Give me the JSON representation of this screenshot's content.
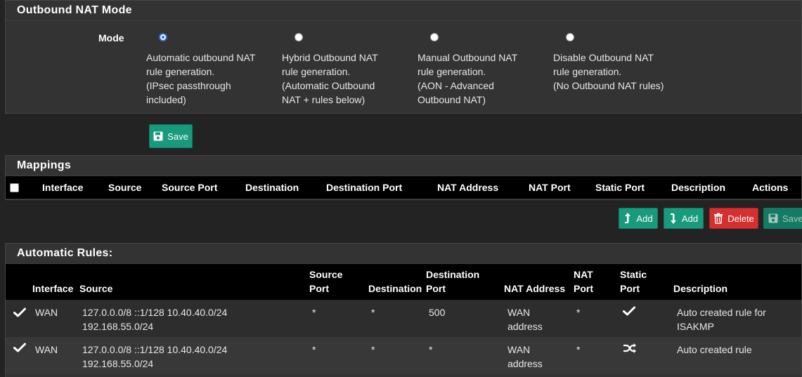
{
  "mode_panel": {
    "title": "Outbound NAT Mode",
    "mode_label": "Mode",
    "options": [
      {
        "text": "Automatic outbound NAT\nrule generation.\n(IPsec passthrough\nincluded)",
        "checked": true
      },
      {
        "text": "Hybrid Outbound NAT\nrule generation.\n(Automatic Outbound\nNAT + rules below)",
        "checked": false
      },
      {
        "text": "Manual Outbound NAT\nrule generation.\n(AON - Advanced\nOutbound NAT)",
        "checked": false
      },
      {
        "text": "Disable Outbound NAT\nrule generation.\n(No Outbound NAT rules)",
        "checked": false
      }
    ],
    "save_label": "Save"
  },
  "mappings": {
    "title": "Mappings",
    "columns": [
      "Interface",
      "Source",
      "Source Port",
      "Destination",
      "Destination Port",
      "NAT Address",
      "NAT Port",
      "Static Port",
      "Description",
      "Actions"
    ],
    "buttons": {
      "add_top": "Add",
      "add_bottom": "Add",
      "delete": "Delete",
      "save": "Save"
    }
  },
  "automatic_rules": {
    "title": "Automatic Rules:",
    "columns": [
      "Interface",
      "Source",
      "Source\nPort",
      "Destination",
      "Destination\nPort",
      "NAT Address",
      "NAT\nPort",
      "Static\nPort",
      "Description"
    ],
    "rows": [
      {
        "interface": "WAN",
        "source": "127.0.0.0/8 ::1/128 10.40.40.0/24\n192.168.55.0/24",
        "source_port": "*",
        "destination": "*",
        "destination_port": "500",
        "nat_address": "WAN\naddress",
        "nat_port": "*",
        "static_port_icon": "check-icon",
        "description": "Auto created rule for\nISAKMP"
      },
      {
        "interface": "WAN",
        "source": "127.0.0.0/8 ::1/128 10.40.40.0/24\n192.168.55.0/24",
        "source_port": "*",
        "destination": "*",
        "destination_port": "*",
        "nat_address": "WAN\naddress",
        "nat_port": "*",
        "static_port_icon": "random-icon",
        "description": "Auto created rule"
      }
    ]
  },
  "colors": {
    "accent_green": "#189a7d",
    "danger_red": "#d62f2f",
    "header_black": "#000000",
    "panel": "#333333"
  }
}
